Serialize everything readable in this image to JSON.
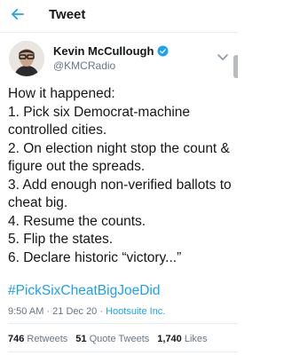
{
  "header": {
    "title": "Tweet"
  },
  "author": {
    "name": "Kevin McCullough",
    "handle": "@KMCRadio",
    "verified": true
  },
  "tweet": {
    "text": "How it happened:\n1. Pick six Democrat-machine controlled cities.\n2. On election night stop the count & figure out the spreads.\n3. Add enough non-verified ballots to cheat big.\n4. Resume the counts.\n5. Flip the states.\n6. Declare historic “victory...”",
    "hashtag": "#PickSixCheatBigJoeDid",
    "time": "9:50 AM",
    "separator": "·",
    "date": "21 Dec 20",
    "source": "Hootsuite Inc."
  },
  "stats": {
    "retweets_count": "746",
    "retweets_label": "Retweets",
    "quotes_count": "51",
    "quotes_label": "Quote Tweets",
    "likes_count": "1,740",
    "likes_label": "Likes"
  },
  "colors": {
    "accent": "#1da1f2",
    "text": "#14171a",
    "muted": "#657786",
    "divider": "#e6ecf0"
  }
}
